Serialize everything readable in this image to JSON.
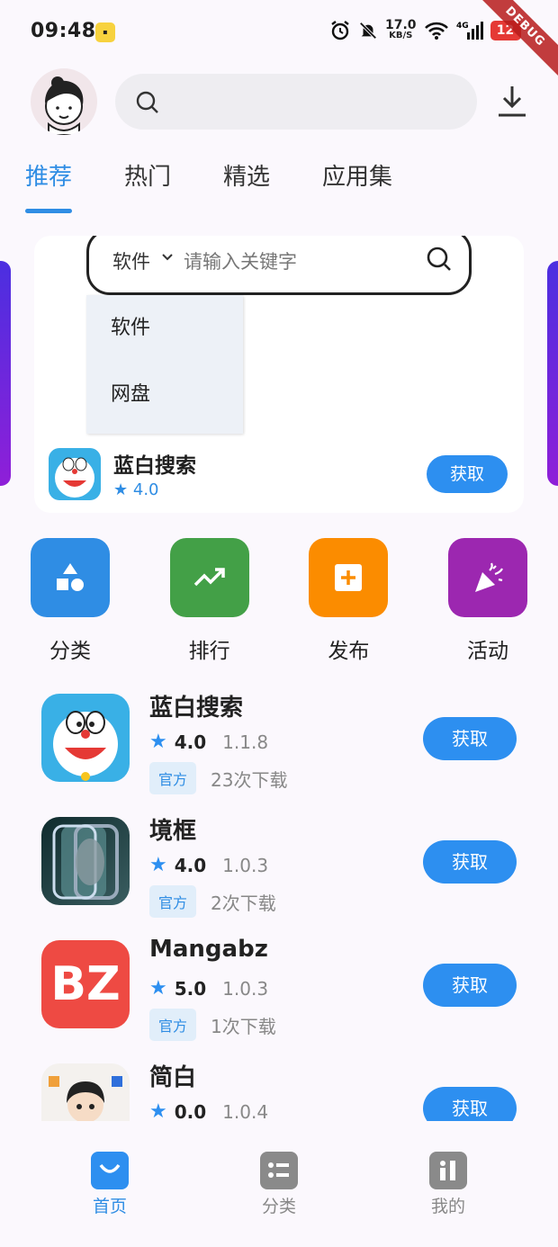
{
  "status_bar": {
    "time": "09:48",
    "net_speed_value": "17.0",
    "net_speed_unit": "KB/S",
    "network": "4G",
    "battery": "12",
    "debug_banner": "DEBUG"
  },
  "header": {
    "avatar": "avatar",
    "search_icon": "search-icon",
    "download_icon": "download-icon"
  },
  "tabs": [
    {
      "label": "推荐",
      "active": true
    },
    {
      "label": "热门",
      "active": false
    },
    {
      "label": "精选",
      "active": false
    },
    {
      "label": "应用集",
      "active": false
    }
  ],
  "banner": {
    "search": {
      "type_selected": "软件",
      "placeholder": "请输入关键字"
    },
    "dropdown_options": [
      "软件",
      "网盘"
    ],
    "app": {
      "name": "蓝白搜索",
      "rating": "4.0",
      "button": "获取"
    }
  },
  "actions": [
    {
      "label": "分类",
      "icon": "shapes-icon",
      "color": "#2f8de4"
    },
    {
      "label": "排行",
      "icon": "trending-icon",
      "color": "#43a047"
    },
    {
      "label": "发布",
      "icon": "add-box-icon",
      "color": "#fb8c00"
    },
    {
      "label": "活动",
      "icon": "celebration-icon",
      "color": "#9c27b0"
    }
  ],
  "apps": [
    {
      "name": "蓝白搜索",
      "rating": "4.0",
      "version": "1.1.8",
      "tag": "官方",
      "downloads": "23次下载",
      "button": "获取"
    },
    {
      "name": "境框",
      "rating": "4.0",
      "version": "1.0.3",
      "tag": "官方",
      "downloads": "2次下载",
      "button": "获取"
    },
    {
      "name": "Mangabz",
      "rating": "5.0",
      "version": "1.0.3",
      "tag": "官方",
      "downloads": "1次下载",
      "button": "获取"
    },
    {
      "name": "简白",
      "rating": "0.0",
      "version": "1.0.4",
      "tag": "",
      "downloads": "",
      "button": "获取"
    }
  ],
  "app_icon_text": {
    "mangabz": "BZ"
  },
  "bottom_nav": [
    {
      "label": "首页",
      "active": true
    },
    {
      "label": "分类",
      "active": false
    },
    {
      "label": "我的",
      "active": false
    }
  ],
  "colors": {
    "accent": "#2f8de4",
    "button": "#2d8ff0",
    "banner_side": "#6a25dc"
  }
}
